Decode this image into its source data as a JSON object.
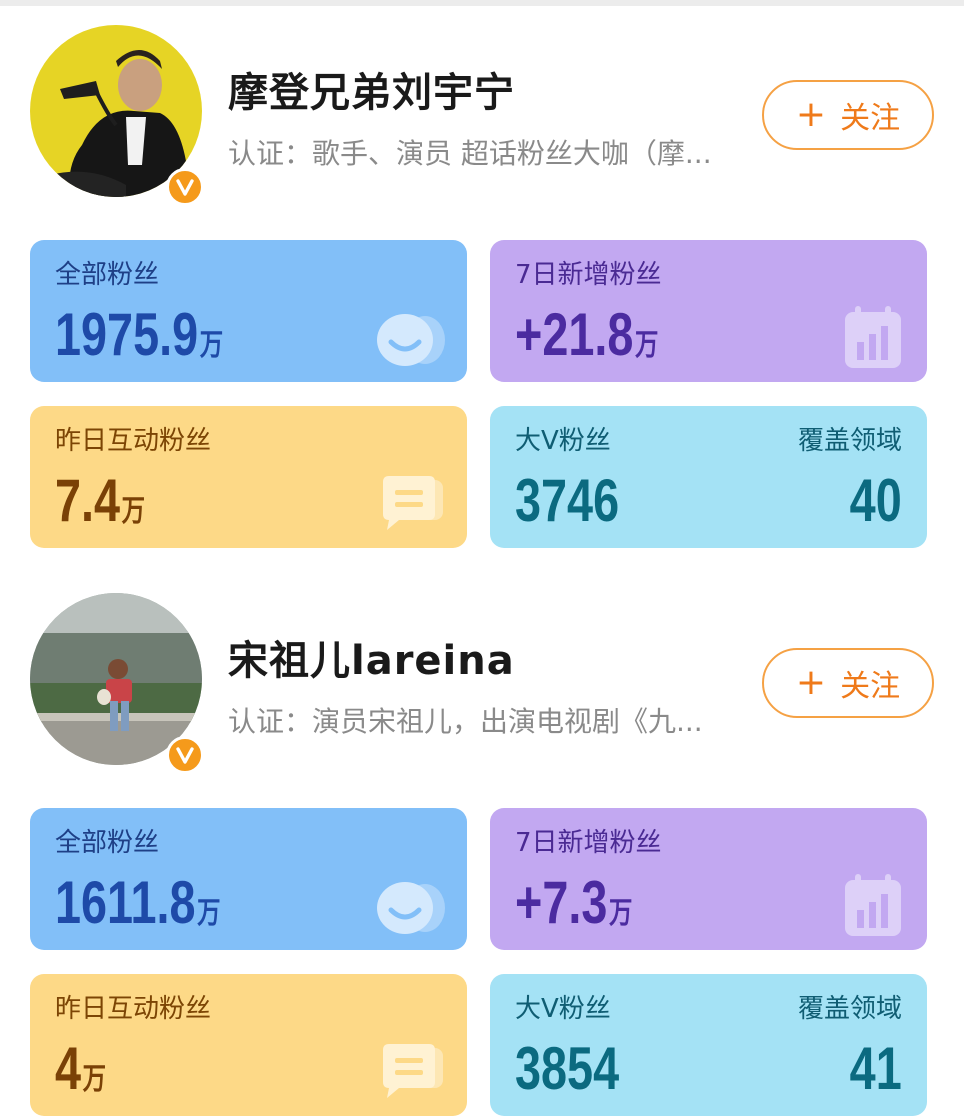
{
  "profiles": [
    {
      "name": "摩登兄弟刘宇宁",
      "certification": "认证：歌手、演员 超话粉丝大咖（摩...",
      "follow_label": "关注",
      "stats": {
        "total_fans": {
          "label": "全部粉丝",
          "value": "1975.9",
          "unit": "万"
        },
        "new_fans_7d": {
          "label": "7日新增粉丝",
          "value": "+21.8",
          "unit": "万"
        },
        "interactive_fans_yesterday": {
          "label": "昨日互动粉丝",
          "value": "7.4",
          "unit": "万"
        },
        "bigv_fans": {
          "label": "大V粉丝",
          "value": "3746"
        },
        "coverage": {
          "label": "覆盖领域",
          "value": "40"
        }
      }
    },
    {
      "name": "宋祖儿lareina",
      "certification": "认证：演员宋祖儿，出演电视剧《九...",
      "follow_label": "关注",
      "stats": {
        "total_fans": {
          "label": "全部粉丝",
          "value": "1611.8",
          "unit": "万"
        },
        "new_fans_7d": {
          "label": "7日新增粉丝",
          "value": "+7.3",
          "unit": "万"
        },
        "interactive_fans_yesterday": {
          "label": "昨日互动粉丝",
          "value": "4",
          "unit": "万"
        },
        "bigv_fans": {
          "label": "大V粉丝",
          "value": "3854"
        },
        "coverage": {
          "label": "覆盖领域",
          "value": "41"
        }
      }
    }
  ],
  "colors": {
    "follow_accent": "#ef7a1a",
    "verified_badge": "#f59a1b",
    "card_blue": "#82bff8",
    "card_purple": "#c2a8f1",
    "card_yellow": "#fdd987",
    "card_cyan": "#a4e2f5"
  },
  "icons": {
    "verified": "verified-v-icon",
    "follow": "plus-icon",
    "total_fans": "fans-people-icon",
    "new_fans": "calendar-chart-icon",
    "interactive": "chat-bubble-icon"
  }
}
